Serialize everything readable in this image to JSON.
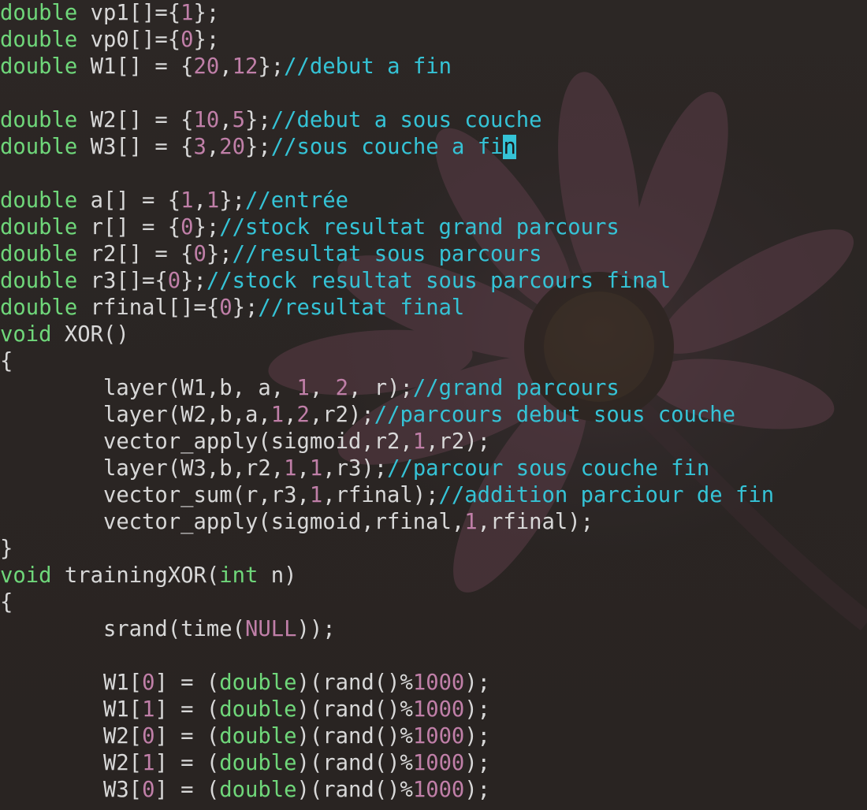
{
  "colors": {
    "plain": "#d8d8d8",
    "type_keyword": "#6fd77a",
    "number": "#c07fa8",
    "comment": "#35c3d6",
    "cursor_bg": "#35c3d6",
    "background": "#2a2624"
  },
  "cursor": {
    "line": 6,
    "char": "n"
  },
  "code_lines": [
    [
      [
        "ty",
        "double"
      ],
      [
        "p",
        " vp1[]={"
      ],
      [
        "num",
        "1"
      ],
      [
        "p",
        "};"
      ]
    ],
    [
      [
        "ty",
        "double"
      ],
      [
        "p",
        " vp0[]={"
      ],
      [
        "num",
        "0"
      ],
      [
        "p",
        "};"
      ]
    ],
    [
      [
        "ty",
        "double"
      ],
      [
        "p",
        " W1[] = {"
      ],
      [
        "num",
        "20"
      ],
      [
        "p",
        ","
      ],
      [
        "num",
        "12"
      ],
      [
        "p",
        "};"
      ],
      [
        "cm",
        "//debut a fin"
      ]
    ],
    [],
    [
      [
        "ty",
        "double"
      ],
      [
        "p",
        " W2[] = {"
      ],
      [
        "num",
        "10"
      ],
      [
        "p",
        ","
      ],
      [
        "num",
        "5"
      ],
      [
        "p",
        "};"
      ],
      [
        "cm",
        "//debut a sous couche"
      ]
    ],
    [
      [
        "ty",
        "double"
      ],
      [
        "p",
        " W3[] = {"
      ],
      [
        "num",
        "3"
      ],
      [
        "p",
        ","
      ],
      [
        "num",
        "20"
      ],
      [
        "p",
        "};"
      ],
      [
        "cm",
        "//sous couche a fi"
      ],
      [
        "cur",
        "n"
      ]
    ],
    [],
    [
      [
        "ty",
        "double"
      ],
      [
        "p",
        " a[] = {"
      ],
      [
        "num",
        "1"
      ],
      [
        "p",
        ","
      ],
      [
        "num",
        "1"
      ],
      [
        "p",
        "};"
      ],
      [
        "cm",
        "//entrée"
      ]
    ],
    [
      [
        "ty",
        "double"
      ],
      [
        "p",
        " r[] = {"
      ],
      [
        "num",
        "0"
      ],
      [
        "p",
        "};"
      ],
      [
        "cm",
        "//stock resultat grand parcours"
      ]
    ],
    [
      [
        "ty",
        "double"
      ],
      [
        "p",
        " r2[] = {"
      ],
      [
        "num",
        "0"
      ],
      [
        "p",
        "};"
      ],
      [
        "cm",
        "//resultat sous parcours"
      ]
    ],
    [
      [
        "ty",
        "double"
      ],
      [
        "p",
        " r3[]={"
      ],
      [
        "num",
        "0"
      ],
      [
        "p",
        "};"
      ],
      [
        "cm",
        "//stock resultat sous parcours final"
      ]
    ],
    [
      [
        "ty",
        "double"
      ],
      [
        "p",
        " rfinal[]={"
      ],
      [
        "num",
        "0"
      ],
      [
        "p",
        "};"
      ],
      [
        "cm",
        "//resultat final"
      ]
    ],
    [
      [
        "ty",
        "void"
      ],
      [
        "p",
        " XOR()"
      ]
    ],
    [
      [
        "p",
        "{"
      ]
    ],
    [
      [
        "p",
        "        layer(W1,b, a, "
      ],
      [
        "num",
        "1"
      ],
      [
        "p",
        ", "
      ],
      [
        "num",
        "2"
      ],
      [
        "p",
        ", r);"
      ],
      [
        "cm",
        "//grand parcours"
      ]
    ],
    [
      [
        "p",
        "        layer(W2,b,a,"
      ],
      [
        "num",
        "1"
      ],
      [
        "p",
        ","
      ],
      [
        "num",
        "2"
      ],
      [
        "p",
        ",r2);"
      ],
      [
        "cm",
        "//parcours debut sous couche"
      ]
    ],
    [
      [
        "p",
        "        vector_apply(sigmoid,r2,"
      ],
      [
        "num",
        "1"
      ],
      [
        "p",
        ",r2);"
      ]
    ],
    [
      [
        "p",
        "        layer(W3,b,r2,"
      ],
      [
        "num",
        "1"
      ],
      [
        "p",
        ","
      ],
      [
        "num",
        "1"
      ],
      [
        "p",
        ",r3);"
      ],
      [
        "cm",
        "//parcour sous couche fin"
      ]
    ],
    [
      [
        "p",
        "        vector_sum(r,r3,"
      ],
      [
        "num",
        "1"
      ],
      [
        "p",
        ",rfinal);"
      ],
      [
        "cm",
        "//addition parciour de fin"
      ]
    ],
    [
      [
        "p",
        "        vector_apply(sigmoid,rfinal,"
      ],
      [
        "num",
        "1"
      ],
      [
        "p",
        ",rfinal);"
      ]
    ],
    [
      [
        "p",
        "}"
      ]
    ],
    [
      [
        "ty",
        "void"
      ],
      [
        "p",
        " trainingXOR("
      ],
      [
        "ty",
        "int"
      ],
      [
        "p",
        " n)"
      ]
    ],
    [
      [
        "p",
        "{"
      ]
    ],
    [
      [
        "p",
        "        srand(time("
      ],
      [
        "num",
        "NULL"
      ],
      [
        "p",
        "));"
      ]
    ],
    [],
    [
      [
        "p",
        "        W1["
      ],
      [
        "num",
        "0"
      ],
      [
        "p",
        "] = ("
      ],
      [
        "ty",
        "double"
      ],
      [
        "p",
        ")(rand()%"
      ],
      [
        "num",
        "1000"
      ],
      [
        "p",
        ");"
      ]
    ],
    [
      [
        "p",
        "        W1["
      ],
      [
        "num",
        "1"
      ],
      [
        "p",
        "] = ("
      ],
      [
        "ty",
        "double"
      ],
      [
        "p",
        ")(rand()%"
      ],
      [
        "num",
        "1000"
      ],
      [
        "p",
        ");"
      ]
    ],
    [
      [
        "p",
        "        W2["
      ],
      [
        "num",
        "0"
      ],
      [
        "p",
        "] = ("
      ],
      [
        "ty",
        "double"
      ],
      [
        "p",
        ")(rand()%"
      ],
      [
        "num",
        "1000"
      ],
      [
        "p",
        ");"
      ]
    ],
    [
      [
        "p",
        "        W2["
      ],
      [
        "num",
        "1"
      ],
      [
        "p",
        "] = ("
      ],
      [
        "ty",
        "double"
      ],
      [
        "p",
        ")(rand()%"
      ],
      [
        "num",
        "1000"
      ],
      [
        "p",
        ");"
      ]
    ],
    [
      [
        "p",
        "        W3["
      ],
      [
        "num",
        "0"
      ],
      [
        "p",
        "] = ("
      ],
      [
        "ty",
        "double"
      ],
      [
        "p",
        ")(rand()%"
      ],
      [
        "num",
        "1000"
      ],
      [
        "p",
        ");"
      ]
    ]
  ]
}
